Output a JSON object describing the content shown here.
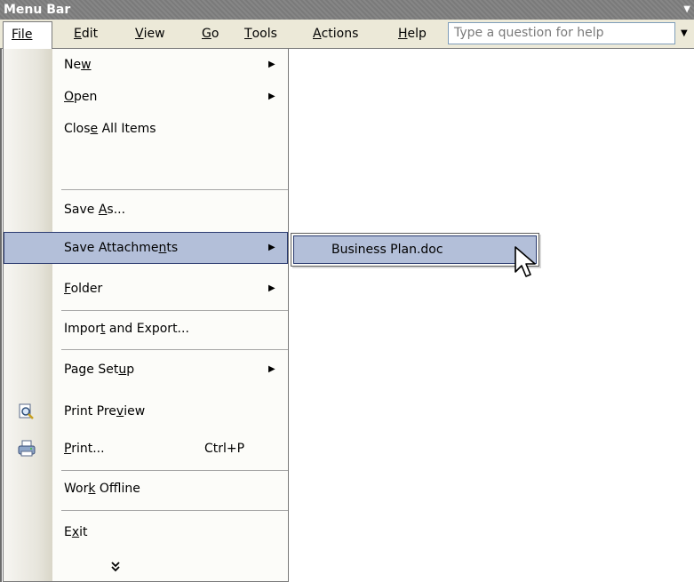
{
  "titlebar": {
    "title": "Menu Bar"
  },
  "menubar": {
    "items": [
      {
        "u": "F",
        "rest": "ile"
      },
      {
        "u": "E",
        "rest": "dit"
      },
      {
        "u": "V",
        "rest": "iew"
      },
      {
        "u": "G",
        "rest": "o"
      },
      {
        "u": "T",
        "rest": "ools"
      },
      {
        "u": "A",
        "rest": "ctions"
      },
      {
        "u": "H",
        "rest": "elp"
      }
    ],
    "help_placeholder": "Type a question for help"
  },
  "file_menu": {
    "items": [
      {
        "pre": "Ne",
        "u": "w",
        "post": "",
        "submenu": true
      },
      {
        "pre": "",
        "u": "O",
        "post": "pen",
        "submenu": true
      },
      {
        "pre": "Clos",
        "u": "e",
        "post": " All Items"
      },
      {
        "pre": "Save ",
        "u": "A",
        "post": "s..."
      },
      {
        "pre": "Save Attachme",
        "u": "n",
        "post": "ts",
        "submenu": true,
        "highlighted": true
      },
      {
        "pre": "",
        "u": "F",
        "post": "older",
        "submenu": true
      },
      {
        "pre": "Impor",
        "u": "t",
        "post": " and Export..."
      },
      {
        "pre": "Page Set",
        "u": "u",
        "post": "p",
        "submenu": true
      },
      {
        "pre": "Print Pre",
        "u": "v",
        "post": "iew",
        "icon": "print-preview-icon"
      },
      {
        "pre": "",
        "u": "P",
        "post": "rint...",
        "shortcut": "Ctrl+P",
        "icon": "printer-icon"
      },
      {
        "pre": "Wor",
        "u": "k",
        "post": " Offline"
      },
      {
        "pre": "E",
        "u": "x",
        "post": "it"
      }
    ]
  },
  "attachments_submenu": {
    "items": [
      {
        "label": "Business Plan.doc"
      }
    ]
  },
  "icons": {
    "expand": "chevron-double-down-icon",
    "cursor": "mouse-pointer-icon"
  },
  "colors": {
    "highlight": "#b3bfd9",
    "highlight_border": "#2b3b70",
    "menubar": "#ece9d8"
  }
}
